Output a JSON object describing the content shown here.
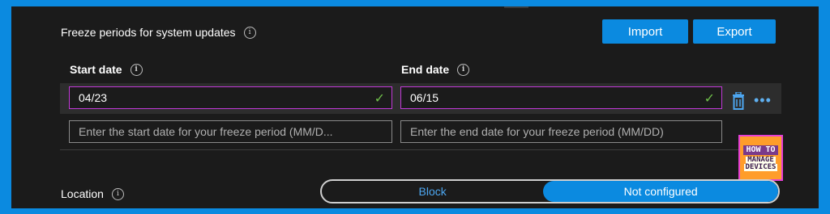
{
  "section": {
    "title": "Freeze periods for system updates",
    "import_label": "Import",
    "export_label": "Export"
  },
  "columns": {
    "start_label": "Start date",
    "end_label": "End date"
  },
  "rows": [
    {
      "start_value": "04/23",
      "end_value": "06/15"
    }
  ],
  "new_row": {
    "start_placeholder": "Enter the start date for your freeze period (MM/D...",
    "end_placeholder": "Enter the end date for your freeze period (MM/DD)"
  },
  "icons": {
    "info": "info-icon",
    "check": "check-icon",
    "delete": "trash-icon",
    "more": "more-icon"
  },
  "watermark": {
    "line1": "HOW TO",
    "line2": "MANAGE",
    "line3": "DEVICES"
  },
  "location": {
    "label": "Location",
    "options": [
      "Block",
      "Not configured"
    ],
    "selected": "Not configured"
  },
  "colors": {
    "accent": "#0b8ae0",
    "focus_border": "#c239d8",
    "valid_check": "#6fbf4a",
    "panel_bg": "#1b1b1b"
  }
}
